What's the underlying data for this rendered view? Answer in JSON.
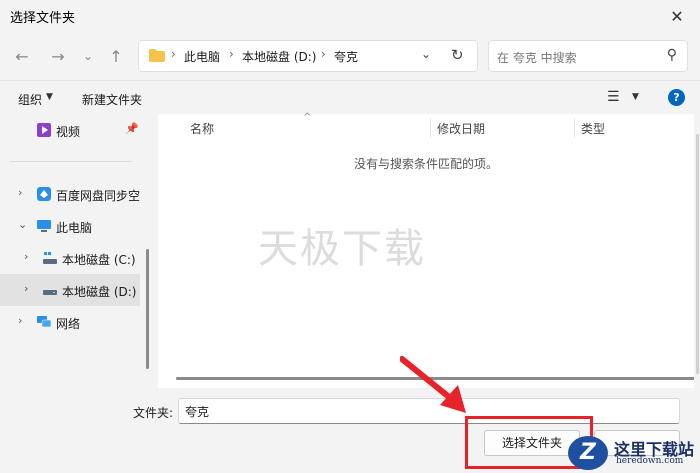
{
  "window": {
    "title": "选择文件夹"
  },
  "address": {
    "crumbs": [
      "此电脑",
      "本地磁盘 (D:)",
      "夸克"
    ]
  },
  "search": {
    "placeholder": "在 夸克 中搜索"
  },
  "toolbar": {
    "organize": "组织",
    "new_folder": "新建文件夹"
  },
  "sidebar": {
    "items": [
      {
        "label": "视频"
      },
      {
        "label": "百度网盘同步空"
      },
      {
        "label": "此电脑"
      },
      {
        "label": "本地磁盘 (C:)"
      },
      {
        "label": "本地磁盘 (D:)"
      },
      {
        "label": "网络"
      }
    ]
  },
  "columns": {
    "name": "名称",
    "modified": "修改日期",
    "type": "类型"
  },
  "empty_message": "没有与搜索条件匹配的项。",
  "watermark": "天极下载",
  "bottom": {
    "folder_label": "文件夹:",
    "folder_value": "夸克",
    "select_button": "选择文件夹"
  },
  "logo": {
    "title": "这里下载站",
    "subtitle": "heredown.com",
    "mark": "Z"
  }
}
